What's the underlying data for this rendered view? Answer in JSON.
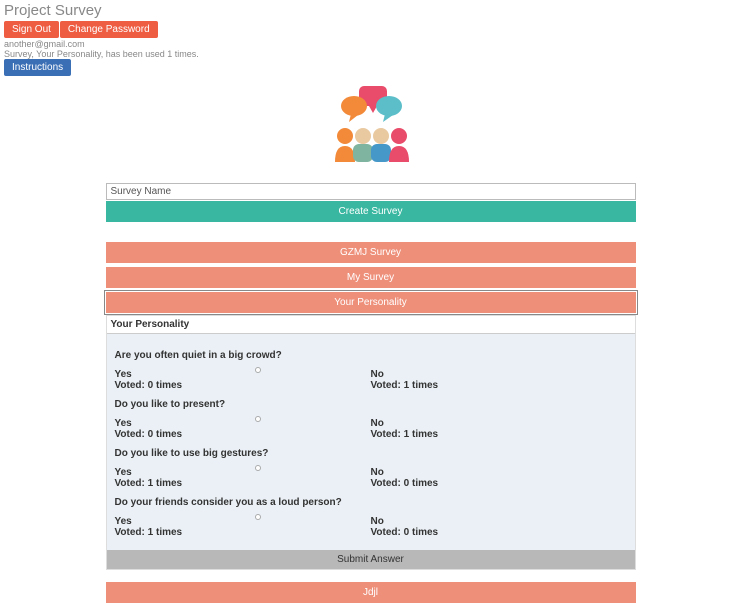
{
  "header": {
    "title": "Project Survey",
    "sign_out": "Sign Out",
    "change_password": "Change Password",
    "email": "another@gmail.com",
    "usage": "Survey, Your Personality, has been used 1 times.",
    "instructions": "Instructions"
  },
  "survey_input": {
    "label": "Survey Name"
  },
  "buttons": {
    "create": "Create Survey",
    "list": [
      "GZMJ Survey",
      "My Survey",
      "Your Personality"
    ],
    "bottom": "Jdjl"
  },
  "panel": {
    "title": "Your Personality",
    "submit": "Submit Answer",
    "questions": [
      {
        "text": "Are you often quiet in a big crowd?",
        "opts": [
          {
            "label": "Yes",
            "votes": "Voted: 0 times"
          },
          {
            "label": "No",
            "votes": "Voted: 1 times"
          }
        ]
      },
      {
        "text": "Do you like to present?",
        "opts": [
          {
            "label": "Yes",
            "votes": "Voted: 0 times"
          },
          {
            "label": "No",
            "votes": "Voted: 1 times"
          }
        ]
      },
      {
        "text": "Do you like to use big gestures?",
        "opts": [
          {
            "label": "Yes",
            "votes": "Voted: 1 times"
          },
          {
            "label": "No",
            "votes": "Voted: 0 times"
          }
        ]
      },
      {
        "text": "Do your friends consider you as a loud person?",
        "opts": [
          {
            "label": "Yes",
            "votes": "Voted: 1 times"
          },
          {
            "label": "No",
            "votes": "Voted: 0 times"
          }
        ]
      }
    ]
  }
}
